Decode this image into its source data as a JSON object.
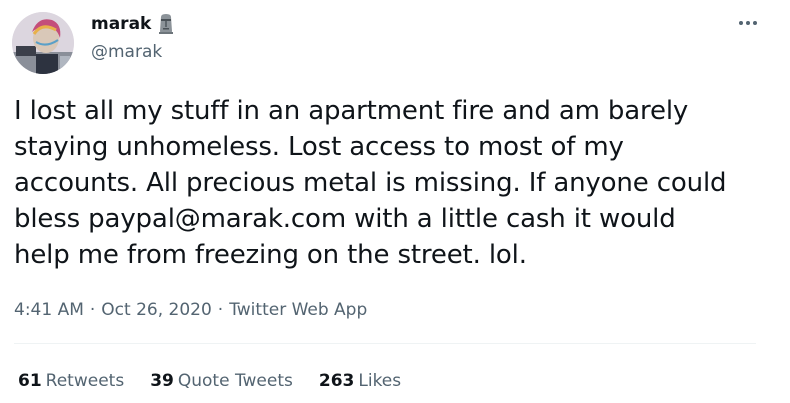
{
  "author": {
    "display_name": "marak",
    "handle": "@marak",
    "avatar_icon": "avatar-photo",
    "name_emoji": "moai-icon"
  },
  "tweet": {
    "text": "I lost all my stuff in an apartment fire and am barely\nstaying unhomeless. Lost access to most of my\naccounts. All precious metal is missing. If anyone could\nbless paypal@marak.com with a little cash it would\nhelp me from freezing on the street. lol.",
    "time": "4:41 AM",
    "separator": "·",
    "date": "Oct 26, 2020",
    "source": "Twitter Web App"
  },
  "stats": {
    "retweets_count": "61",
    "retweets_label": "Retweets",
    "quote_count": "39",
    "quote_label": "Quote Tweets",
    "likes_count": "263",
    "likes_label": "Likes"
  },
  "colors": {
    "text": "#0f1419",
    "secondary": "#536471",
    "divider": "#eff3f4"
  }
}
